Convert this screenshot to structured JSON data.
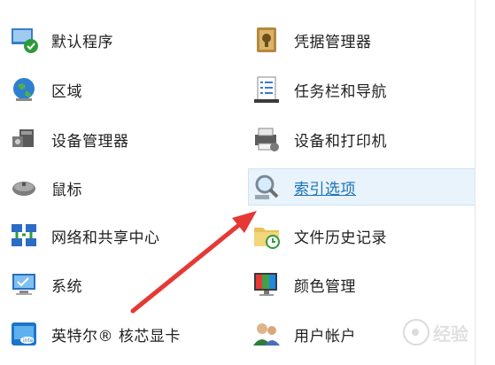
{
  "left_items": [
    {
      "label": "默认程序",
      "icon": "default-programs-icon"
    },
    {
      "label": "区域",
      "icon": "region-globe-icon"
    },
    {
      "label": "设备管理器",
      "icon": "device-manager-icon"
    },
    {
      "label": "鼠标",
      "icon": "mouse-icon"
    },
    {
      "label": "网络和共享中心",
      "icon": "network-sharing-icon"
    },
    {
      "label": "系统",
      "icon": "system-icon"
    },
    {
      "label": "英特尔® 核芯显卡",
      "icon": "intel-graphics-icon"
    }
  ],
  "right_items": [
    {
      "label": "凭据管理器",
      "icon": "credential-manager-icon"
    },
    {
      "label": "任务栏和导航",
      "icon": "taskbar-navigation-icon"
    },
    {
      "label": "设备和打印机",
      "icon": "devices-printers-icon"
    },
    {
      "label": "索引选项",
      "icon": "indexing-options-icon",
      "hovered": true
    },
    {
      "label": "文件历史记录",
      "icon": "file-history-icon"
    },
    {
      "label": "颜色管理",
      "icon": "color-management-icon"
    },
    {
      "label": "用户帐户",
      "icon": "user-accounts-icon"
    }
  ],
  "watermark": {
    "text": "经验"
  },
  "colors": {
    "hover_bg": "#e9f3fb",
    "link_hover": "#1a73b8",
    "arrow": "#e53935"
  }
}
